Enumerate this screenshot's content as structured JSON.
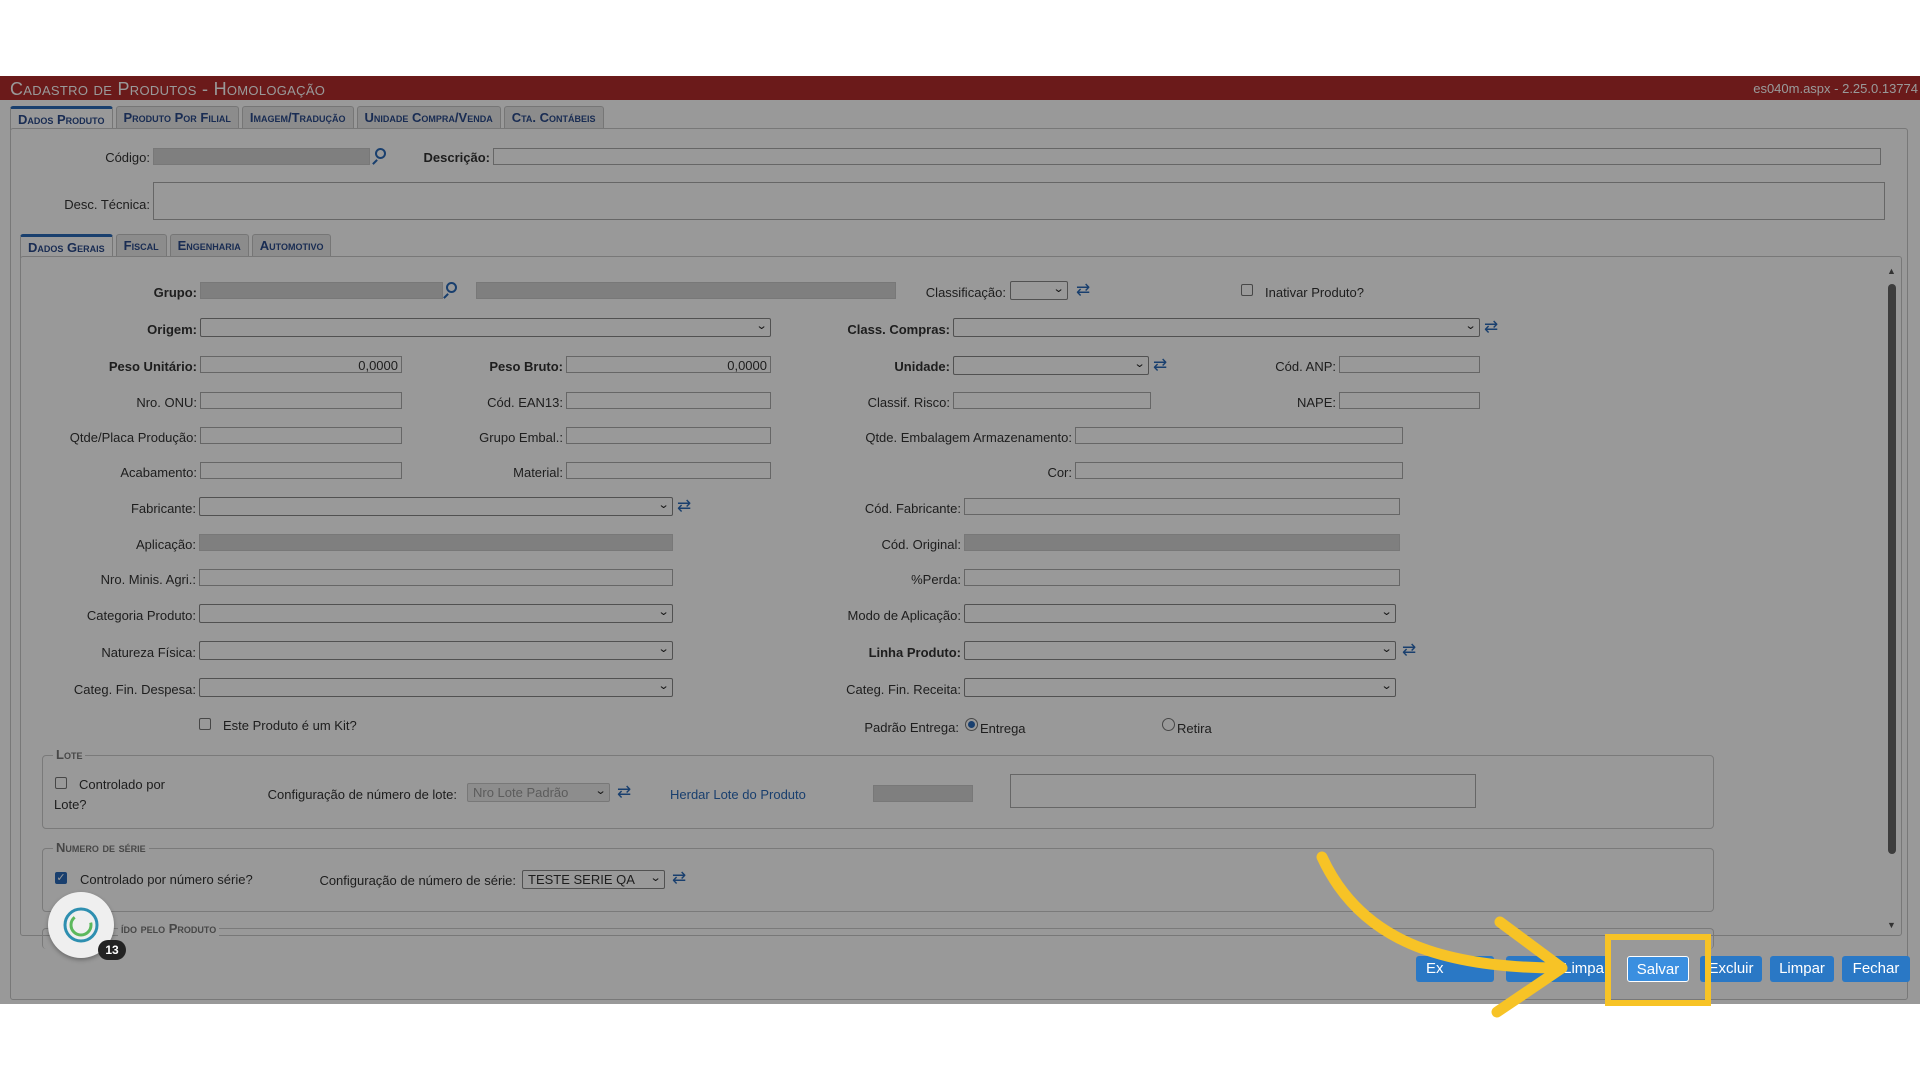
{
  "window": {
    "title": "Cadastro de Produtos  - Homologação",
    "version": "es040m.aspx - 2.25.0.13774"
  },
  "main_tabs": [
    "Dados Produto",
    "Produto Por Filial",
    "Imagem/Tradução",
    "Unidade Compra/Venda",
    "Cta. Contábeis"
  ],
  "header_fields": {
    "codigo_label": "Código:",
    "descricao_label": "Descrição:",
    "desc_tecnica_label": "Desc. Técnica:"
  },
  "sub_tabs": [
    "Dados Gerais",
    "Fiscal",
    "Engenharia",
    "Automotivo"
  ],
  "form": {
    "grupo_label": "Grupo:",
    "classificacao_label": "Classificação:",
    "inativar_label": "Inativar Produto?",
    "origem_label": "Origem:",
    "class_compras_label": "Class. Compras:",
    "peso_unitario_label": "Peso Unitário:",
    "peso_unitario_value": "0,0000",
    "peso_bruto_label": "Peso Bruto:",
    "peso_bruto_value": "0,0000",
    "unidade_label": "Unidade:",
    "cod_anp_label": "Cód. ANP:",
    "nro_onu_label": "Nro. ONU:",
    "cod_ean13_label": "Cód. EAN13:",
    "classif_risco_label": "Classif. Risco:",
    "nape_label": "NAPE:",
    "qtde_placa_label": "Qtde/Placa Produção:",
    "grupo_embal_label": "Grupo Embal.:",
    "qtde_embalagem_label": "Qtde. Embalagem Armazenamento:",
    "acabamento_label": "Acabamento:",
    "material_label": "Material:",
    "cor_label": "Cor:",
    "fabricante_label": "Fabricante:",
    "cod_fabricante_label": "Cód. Fabricante:",
    "aplicacao_label": "Aplicação:",
    "cod_original_label": "Cód. Original:",
    "nro_minis_agri_label": "Nro. Minis. Agri.:",
    "perda_label": "%Perda:",
    "categoria_produto_label": "Categoria Produto:",
    "modo_aplicacao_label": "Modo de Aplicação:",
    "natureza_fisica_label": "Natureza Física:",
    "linha_produto_label": "Linha Produto:",
    "categ_fin_despesa_label": "Categ. Fin. Despesa:",
    "categ_fin_receita_label": "Categ. Fin. Receita:",
    "kit_label": "Este Produto é um Kit?",
    "padrao_entrega_label": "Padrão Entrega:",
    "entrega_label": "Entrega",
    "retira_label": "Retira"
  },
  "lote": {
    "legend": "Lote",
    "controlado_line1": "Controlado por",
    "controlado_line2": "Lote?",
    "config_label": "Configuração de número de lote:",
    "config_value": "Nro Lote Padrão",
    "herdar_link": "Herdar Lote do Produto"
  },
  "serie": {
    "legend": "Numero de série",
    "controlado_label": "Controlado por número série?",
    "controlado_checked": true,
    "config_label": "Configuração de número de série:",
    "config_value": "TESTE SERIE QA"
  },
  "bottom_section": {
    "partial_legend": "ído pelo Produto"
  },
  "assistant": {
    "badge_count": "13"
  },
  "buttons": {
    "b1": "Ex",
    "b2": "r/Limpa",
    "salvar": "Salvar",
    "excluir": "Excluir",
    "limpar": "Limpar",
    "fechar": "Fechar"
  },
  "annotation": {
    "arrow_color": "#f7c326",
    "highlight_color": "#f7c326"
  }
}
